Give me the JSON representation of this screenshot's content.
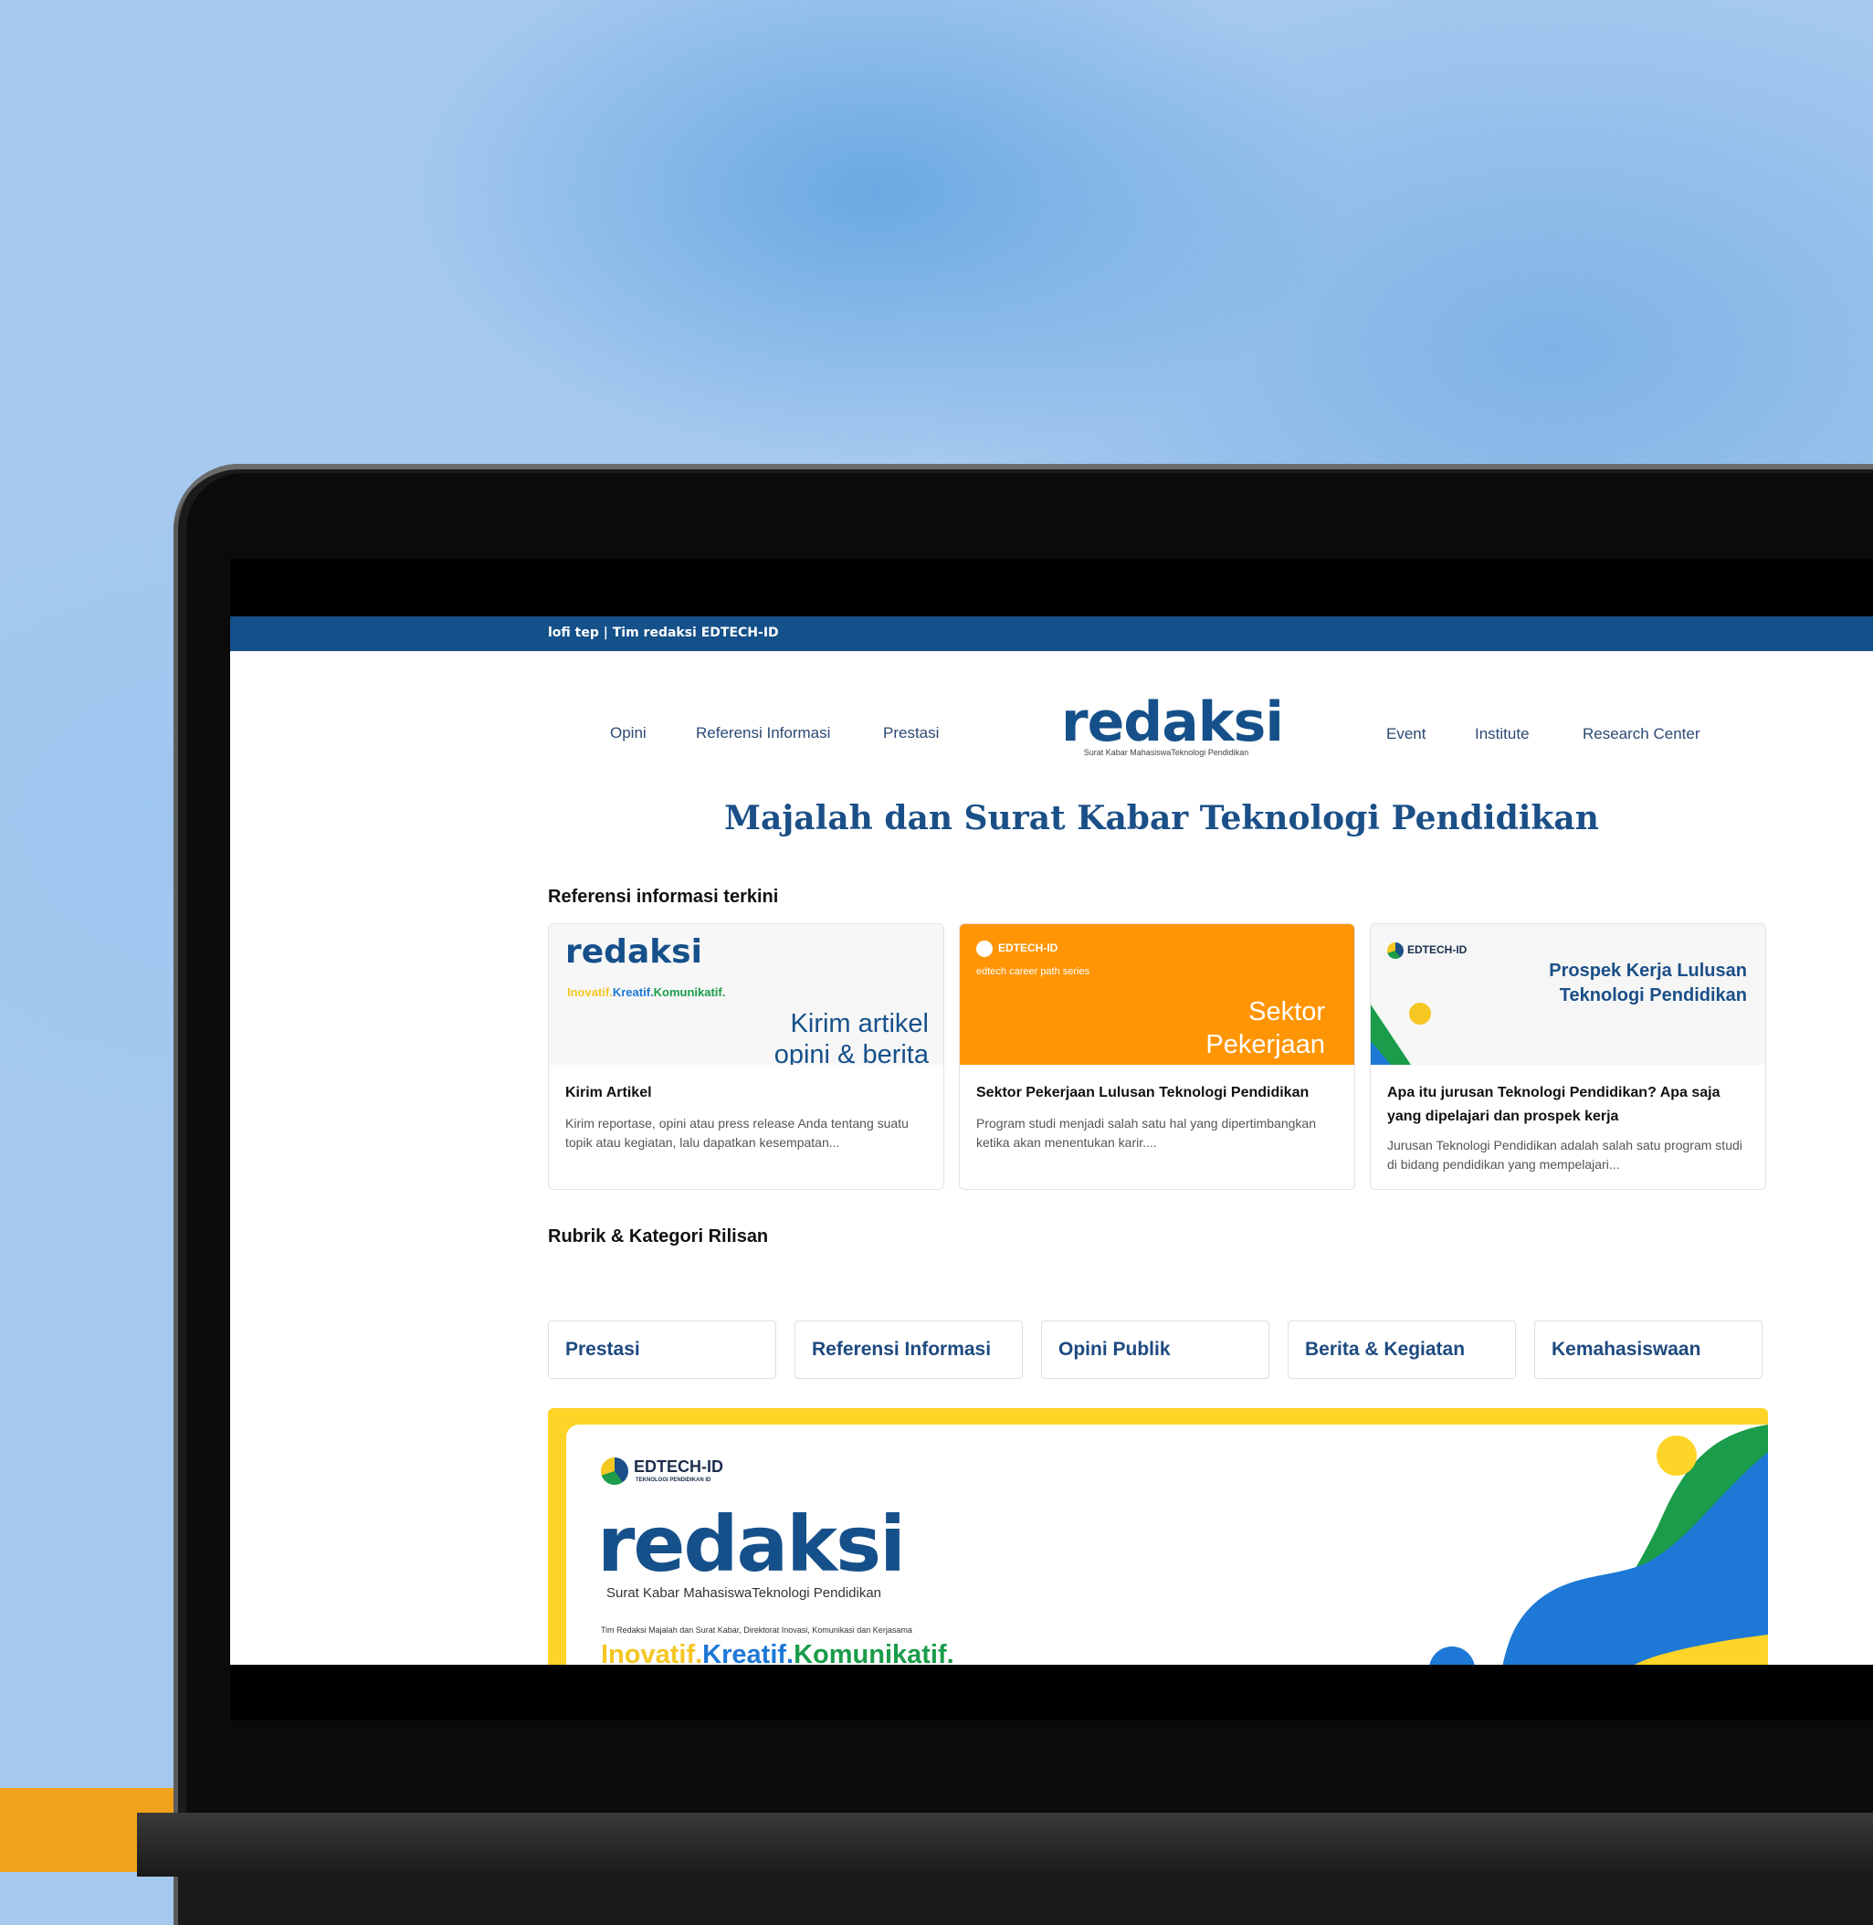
{
  "topbar": {
    "text": "lofi tep | Tim redaksi EDTECH-ID"
  },
  "nav": {
    "left": [
      "Opini",
      "Referensi Informasi",
      "Prestasi"
    ],
    "right": [
      "Event",
      "Institute",
      "Research Center"
    ]
  },
  "logo": {
    "word": "redaksi",
    "subtitle": "Surat Kabar MahasiswaTeknologi Pendidikan"
  },
  "hero": {
    "title": "Majalah dan Surat Kabar Teknologi Pendidikan"
  },
  "section_latest": {
    "heading": "Referensi informasi terkini"
  },
  "cards": [
    {
      "thumb": {
        "logo": "redaksi",
        "tagline": [
          "Inovatif.",
          "Kreatif.",
          "Komunikatif."
        ],
        "headline": [
          "Kirim artikel",
          "opini & berita"
        ]
      },
      "title": "Kirim Artikel",
      "excerpt": "Kirim reportase, opini atau press release Anda tentang suatu topik atau kegiatan, lalu dapatkan kesempatan...",
      "colors": {
        "thumb_bg": "#f7f7f7"
      }
    },
    {
      "thumb": {
        "brand": "EDTECH-ID",
        "series": "edtech career path series",
        "headline": [
          "Sektor",
          "Pekerjaan"
        ]
      },
      "title": "Sektor Pekerjaan Lulusan Teknologi Pendidikan",
      "excerpt": "Program studi menjadi salah satu hal yang dipertimbangkan ketika akan menentukan karir....",
      "colors": {
        "thumb_bg": "#ff9505"
      }
    },
    {
      "thumb": {
        "brand": "EDTECH-ID",
        "headline": [
          "Prospek Kerja Lulusan",
          "Teknologi Pendidikan"
        ]
      },
      "title": "Apa itu jurusan Teknologi Pendidikan? Apa saja yang dipelajari dan prospek kerja",
      "excerpt": "Jurusan Teknologi Pendidikan adalah salah satu program studi di bidang pendidikan yang mempelajari...",
      "colors": {
        "thumb_bg": "#f6f6f6"
      }
    }
  ],
  "section_categories": {
    "heading": "Rubrik & Kategori Rilisan"
  },
  "categories": [
    "Prestasi",
    "Referensi Informasi",
    "Opini Publik",
    "Berita & Kegiatan",
    "Kemahasiswaan"
  ],
  "banner": {
    "brand": "EDTECH-ID",
    "brand_sub": "TEKNOLOGI PENDIDIKAN ID",
    "logo": "redaksi",
    "logo_sub": "Surat Kabar MahasiswaTeknologi Pendidikan",
    "credit": "Tim Redaksi Majalah dan Surat Kabar, Direktorat Inovasi, Komunikasi dan Kerjasama",
    "tagline": [
      "Inovatif.",
      "Kreatif.",
      "Komunikatif."
    ]
  },
  "colors": {
    "brand_blue": "#16508a",
    "topbar": "#145089",
    "accent_yellow": "#fdd427",
    "accent_green": "#1a9c4a",
    "accent_sky": "#1d78d6",
    "orange": "#ff9505"
  },
  "icons": [
    "edtech-logo-icon"
  ]
}
